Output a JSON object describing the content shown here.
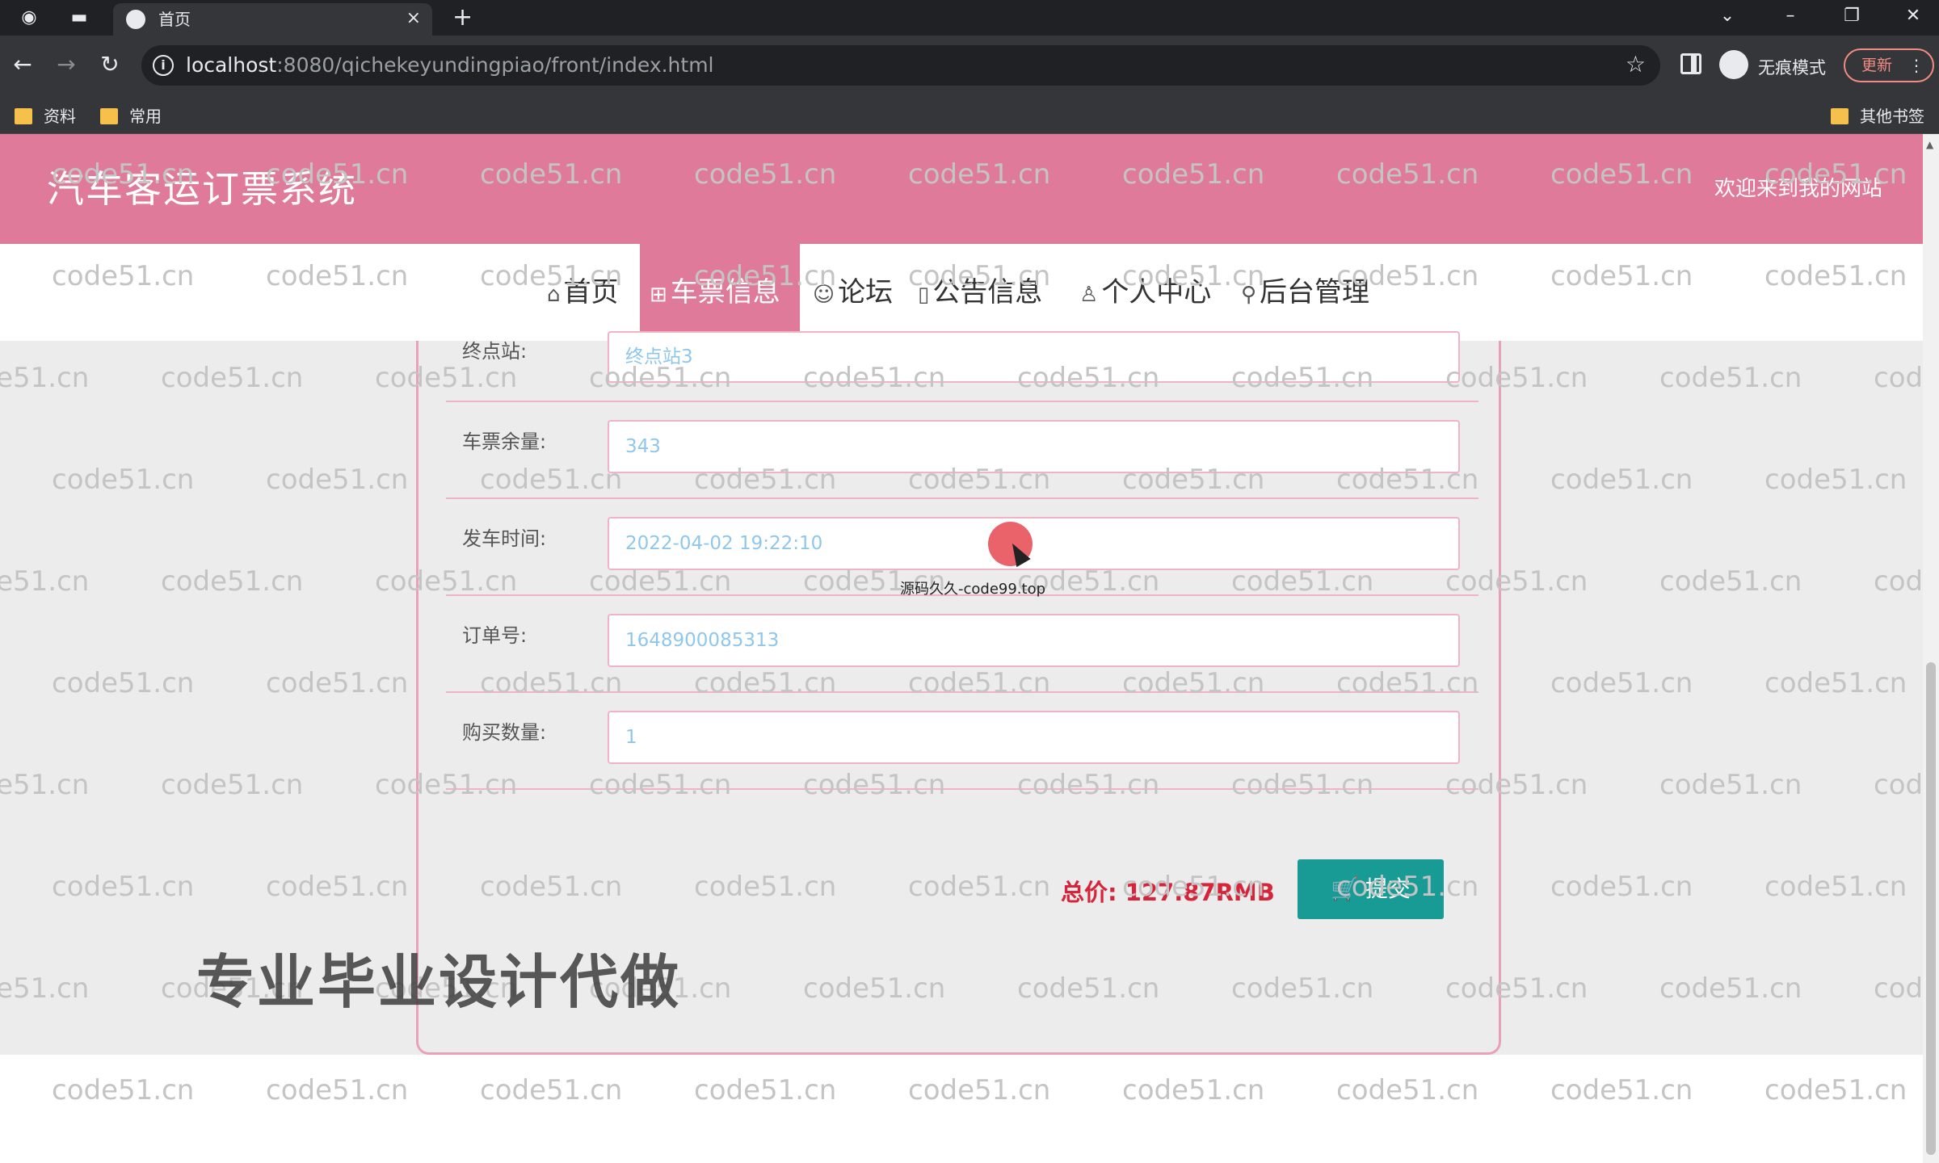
{
  "browser": {
    "tab_title": "首页",
    "tab_close": "×",
    "new_tab": "+",
    "url_host": "localhost",
    "url_path": ":8080/qichekeyundingpiao/front/index.html",
    "incognito_label": "无痕模式",
    "update_label": "更新",
    "bookmarks": [
      "资料",
      "常用"
    ],
    "other_bookmarks": "其他书签"
  },
  "site": {
    "title": "汽车客运订票系统",
    "welcome": "欢迎来到我的网站"
  },
  "nav": {
    "items": [
      {
        "icon": "⌂",
        "label": "首页"
      },
      {
        "icon": "⊞",
        "label": "车票信息"
      },
      {
        "icon": "☺",
        "label": "论坛"
      },
      {
        "icon": "▯",
        "label": "公告信息"
      },
      {
        "icon": "♙",
        "label": "个人中心"
      },
      {
        "icon": "⚲",
        "label": "后台管理"
      }
    ],
    "active_index": 1
  },
  "form": {
    "fields": [
      {
        "label": "终点站:",
        "value": "终点站3"
      },
      {
        "label": "车票余量:",
        "value": "343"
      },
      {
        "label": "发车时间:",
        "value": "2022-04-02 19:22:10"
      },
      {
        "label": "订单号:",
        "value": "1648900085313"
      },
      {
        "label": "购买数量:",
        "value": "1"
      }
    ],
    "total_text": "总价: 127.87RMB",
    "submit_label": "提交"
  },
  "overlay": {
    "promo": "专业毕业设计代做",
    "source_note": "源码久久-code99.top",
    "watermark_text": "code51.cn"
  },
  "colors": {
    "accent_pink": "#e07a9b",
    "submit_teal": "#179b94",
    "total_red": "#d6243b"
  }
}
